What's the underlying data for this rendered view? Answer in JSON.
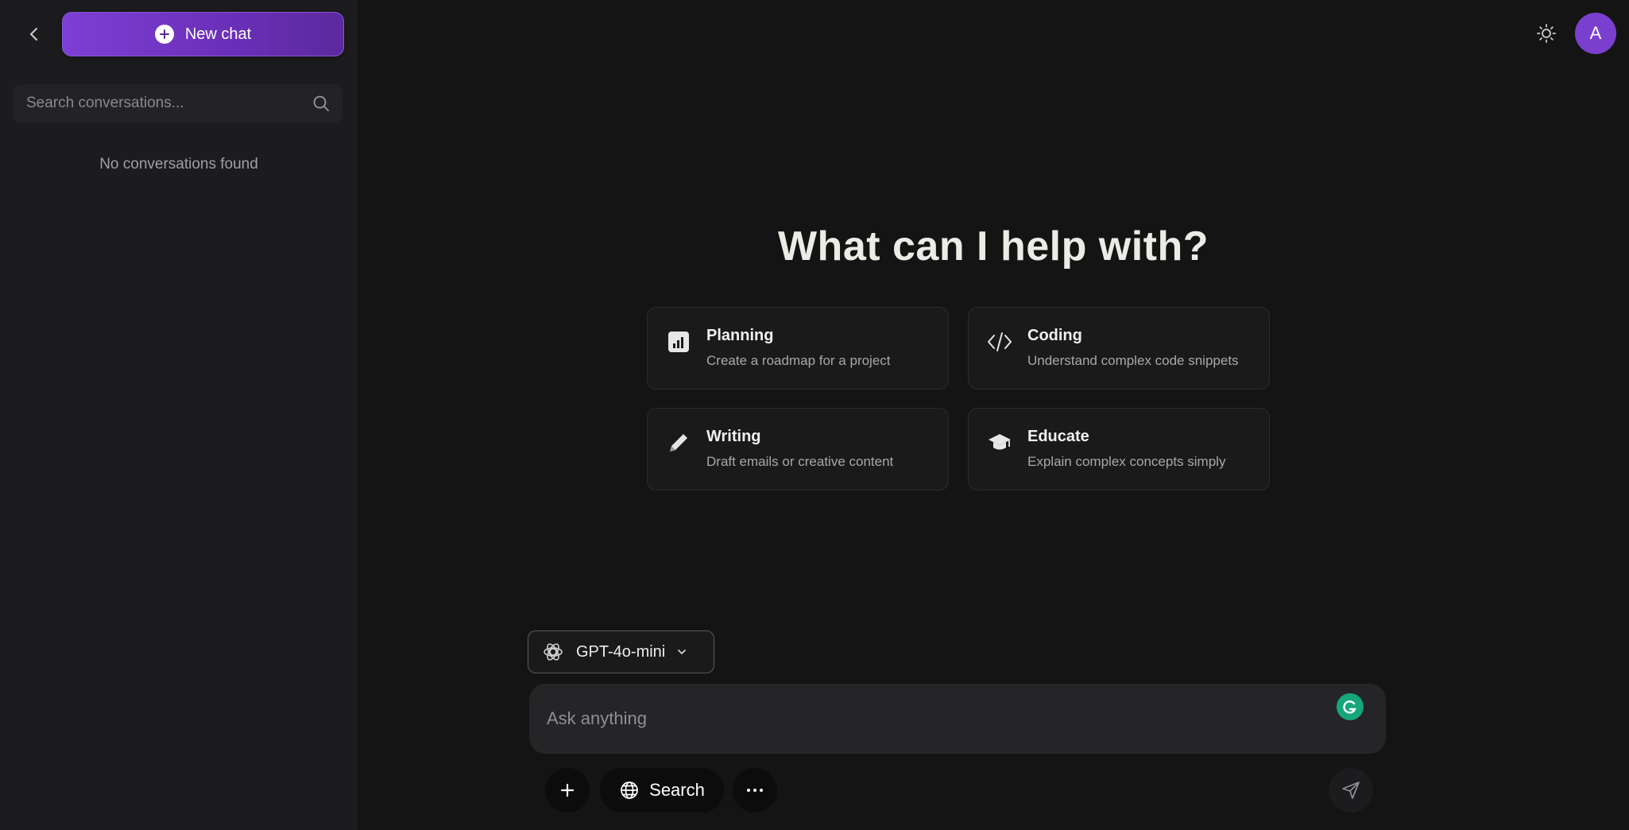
{
  "sidebar": {
    "new_chat_label": "New chat",
    "search_placeholder": "Search conversations...",
    "empty_text": "No conversations found"
  },
  "header": {
    "avatar_initial": "A"
  },
  "main": {
    "headline": "What can I help with?",
    "cards": [
      {
        "title": "Planning",
        "desc": "Create a roadmap for a project",
        "icon": "chart-icon"
      },
      {
        "title": "Coding",
        "desc": "Understand complex code snippets",
        "icon": "code-icon"
      },
      {
        "title": "Writing",
        "desc": "Draft emails or creative content",
        "icon": "pencil-icon"
      },
      {
        "title": "Educate",
        "desc": "Explain complex concepts simply",
        "icon": "graduation-cap-icon"
      }
    ]
  },
  "composer": {
    "model": "GPT-4o-mini",
    "placeholder": "Ask anything",
    "search_label": "Search"
  },
  "colors": {
    "accent": "#7a3fcf",
    "background": "#141414",
    "sidebar": "#1c1c1e",
    "grammarly": "#15a67a"
  }
}
